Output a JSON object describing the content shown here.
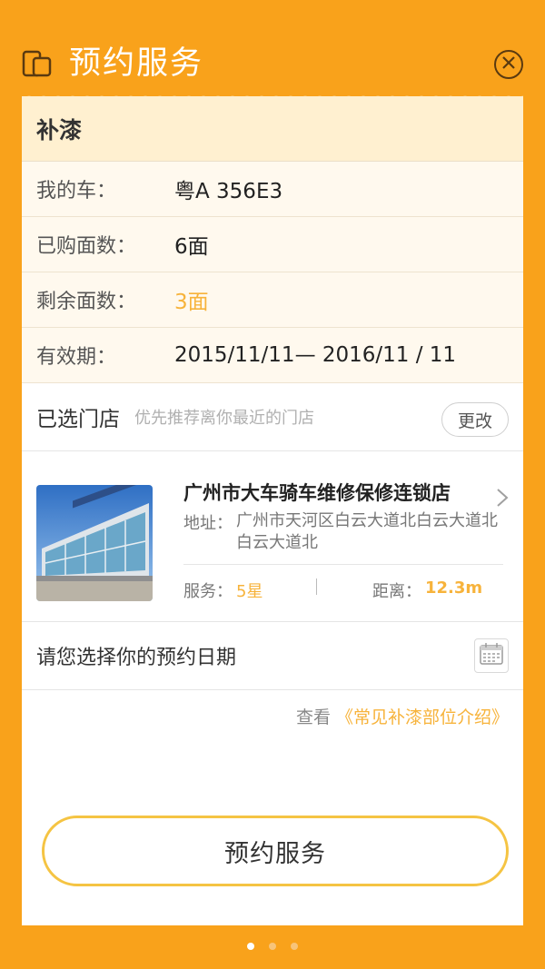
{
  "header": {
    "title": "预约服务",
    "logo_icon": "cards-icon",
    "close_icon": "close-circle-icon"
  },
  "service": {
    "title": "补漆"
  },
  "info_rows": [
    {
      "label": "我的车：",
      "value": "粤A  356E3"
    },
    {
      "label": "已购面数：",
      "value": "6面"
    },
    {
      "label": "剩余面数：",
      "value": "3面"
    },
    {
      "label": "有效期：",
      "value": "2015/11/11— 2016/11 / 11"
    }
  ],
  "store_section": {
    "title": "已选门店",
    "subtitle": "优先推荐离你最近的门店",
    "change_label": "更改"
  },
  "store": {
    "name": "广州市大车骑车维修保修连锁店",
    "address_label": "地址：",
    "address": "广州市天河区白云大道北白云大道北白云大道北",
    "service_label": "服务：",
    "service_value": "5星",
    "distance_label": "距离：",
    "distance_value": "12.3m"
  },
  "date": {
    "label": "请您选择你的预约日期",
    "icon": "calendar-icon"
  },
  "guide": {
    "prefix": "查看",
    "link": "《常见补漆部位介绍》"
  },
  "primary_button": {
    "label": "预约服务"
  },
  "pager": {
    "count": 3,
    "active_index": 0
  },
  "colors": {
    "background": "#F9A21B",
    "accent": "#F7B33B",
    "section_bg": "#FFF0D0",
    "row_bg": "#FFF9EE",
    "button_border": "#F5C443"
  }
}
